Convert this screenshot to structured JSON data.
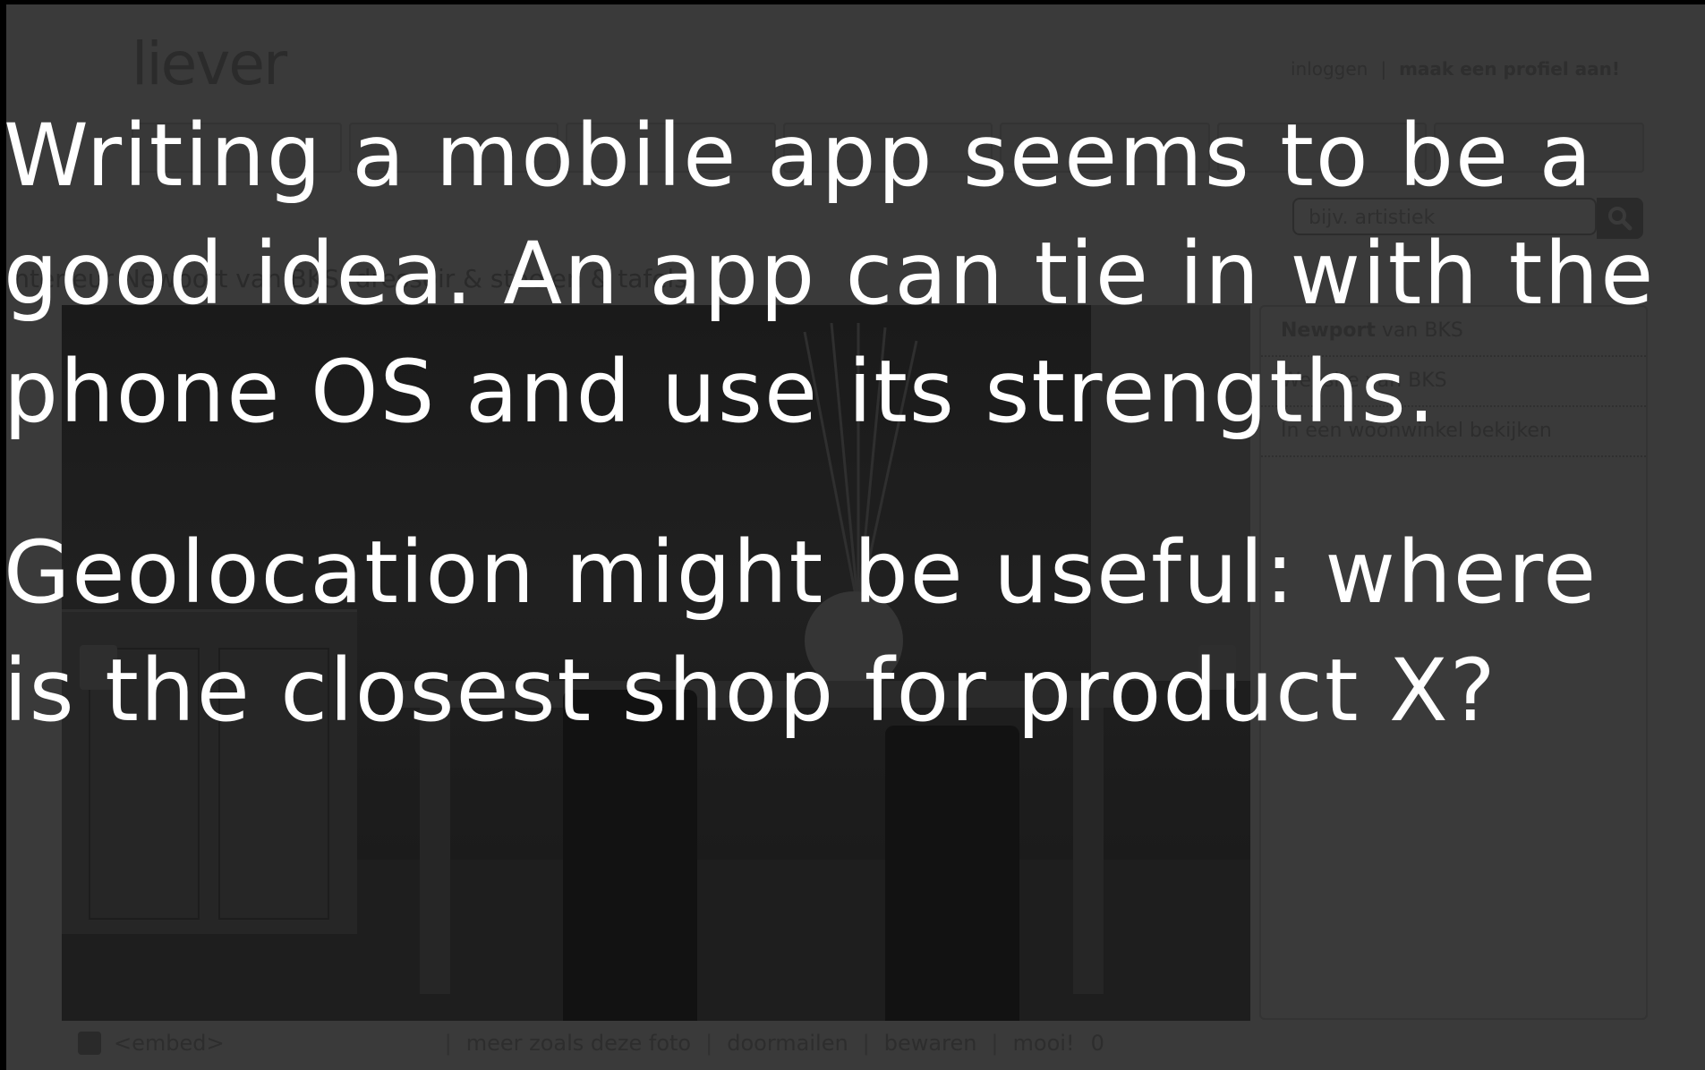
{
  "background_site": {
    "logo": "liever",
    "top_links": {
      "login": "inloggen",
      "separator": "|",
      "register": "maak een profiel aan!"
    },
    "nav_tabs": [
      "",
      "",
      "",
      "",
      "",
      "",
      ""
    ],
    "search": {
      "placeholder": "bijv. artistiek",
      "icon": "search-icon"
    },
    "breadcrumb": "Interieur Newport van BKS, dressoir & stoelen & tafels",
    "sidebar": {
      "items": [
        {
          "bold": "Newport",
          "rest": " van BKS"
        },
        {
          "bold": "",
          "rest": "Website van BKS"
        },
        {
          "bold": "",
          "rest": "In een woonwinkel bekijken"
        }
      ]
    },
    "bottom_bar": {
      "embed": "<embed>",
      "more_like": "meer zoals deze foto",
      "mail": "doormailen",
      "save": "bewaren",
      "like": "mooi!",
      "like_count": "0",
      "separator": "|"
    }
  },
  "slide": {
    "paragraphs": [
      "Writing a mobile app seems to be a good idea. An app can tie in with the phone OS and use its strengths.",
      "Geolocation might be useful: where is the closest shop for product X?"
    ],
    "text_color": "#ffffff",
    "overlay_color": "#000000"
  }
}
